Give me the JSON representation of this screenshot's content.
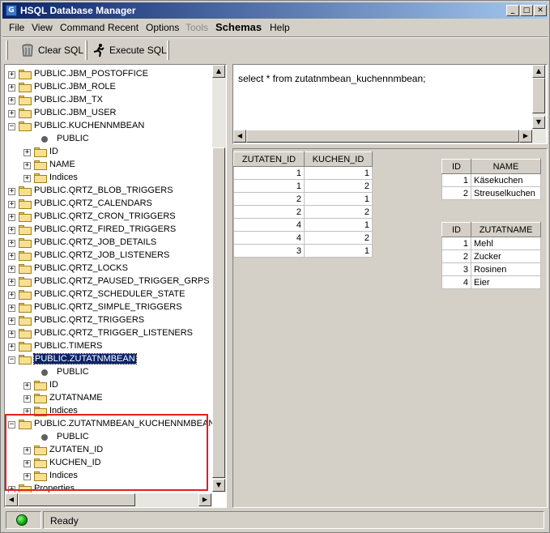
{
  "window": {
    "title": "HSQL Database Manager",
    "app_icon_glyph": "G"
  },
  "menu": {
    "items": [
      "File",
      "View",
      "Command",
      "Recent",
      "Options",
      "Tools",
      "Schemas",
      "Help"
    ]
  },
  "toolbar": {
    "clear_sql_label": "Clear SQL",
    "execute_sql_label": "Execute SQL"
  },
  "tree": {
    "rows": [
      {
        "label": "PUBLIC.JBM_POSTOFFICE",
        "kind": "folder",
        "level": 0,
        "exp": "+"
      },
      {
        "label": "PUBLIC.JBM_ROLE",
        "kind": "folder",
        "level": 0,
        "exp": "+"
      },
      {
        "label": "PUBLIC.JBM_TX",
        "kind": "folder",
        "level": 0,
        "exp": "+"
      },
      {
        "label": "PUBLIC.JBM_USER",
        "kind": "folder",
        "level": 0,
        "exp": "+"
      },
      {
        "label": "PUBLIC.KUCHENNMBEAN",
        "kind": "folder",
        "level": 0,
        "exp": "-"
      },
      {
        "label": "PUBLIC",
        "kind": "dot",
        "level": 1,
        "exp": ""
      },
      {
        "label": "ID",
        "kind": "folder",
        "level": 1,
        "exp": "+"
      },
      {
        "label": "NAME",
        "kind": "folder",
        "level": 1,
        "exp": "+"
      },
      {
        "label": "Indices",
        "kind": "folder",
        "level": 1,
        "exp": "+"
      },
      {
        "label": "PUBLIC.QRTZ_BLOB_TRIGGERS",
        "kind": "folder",
        "level": 0,
        "exp": "+"
      },
      {
        "label": "PUBLIC.QRTZ_CALENDARS",
        "kind": "folder",
        "level": 0,
        "exp": "+"
      },
      {
        "label": "PUBLIC.QRTZ_CRON_TRIGGERS",
        "kind": "folder",
        "level": 0,
        "exp": "+"
      },
      {
        "label": "PUBLIC.QRTZ_FIRED_TRIGGERS",
        "kind": "folder",
        "level": 0,
        "exp": "+"
      },
      {
        "label": "PUBLIC.QRTZ_JOB_DETAILS",
        "kind": "folder",
        "level": 0,
        "exp": "+"
      },
      {
        "label": "PUBLIC.QRTZ_JOB_LISTENERS",
        "kind": "folder",
        "level": 0,
        "exp": "+"
      },
      {
        "label": "PUBLIC.QRTZ_LOCKS",
        "kind": "folder",
        "level": 0,
        "exp": "+"
      },
      {
        "label": "PUBLIC.QRTZ_PAUSED_TRIGGER_GRPS",
        "kind": "folder",
        "level": 0,
        "exp": "+"
      },
      {
        "label": "PUBLIC.QRTZ_SCHEDULER_STATE",
        "kind": "folder",
        "level": 0,
        "exp": "+"
      },
      {
        "label": "PUBLIC.QRTZ_SIMPLE_TRIGGERS",
        "kind": "folder",
        "level": 0,
        "exp": "+"
      },
      {
        "label": "PUBLIC.QRTZ_TRIGGERS",
        "kind": "folder",
        "level": 0,
        "exp": "+"
      },
      {
        "label": "PUBLIC.QRTZ_TRIGGER_LISTENERS",
        "kind": "folder",
        "level": 0,
        "exp": "+"
      },
      {
        "label": "PUBLIC.TIMERS",
        "kind": "folder",
        "level": 0,
        "exp": "+"
      },
      {
        "label": "PUBLIC.ZUTATNMBEAN",
        "kind": "folder",
        "level": 0,
        "exp": "-",
        "selected": true
      },
      {
        "label": "PUBLIC",
        "kind": "dot",
        "level": 1,
        "exp": ""
      },
      {
        "label": "ID",
        "kind": "folder",
        "level": 1,
        "exp": "+"
      },
      {
        "label": "ZUTATNAME",
        "kind": "folder",
        "level": 1,
        "exp": "+"
      },
      {
        "label": "Indices",
        "kind": "folder",
        "level": 1,
        "exp": "+"
      },
      {
        "label": "PUBLIC.ZUTATNMBEAN_KUCHENNMBEAN",
        "kind": "folder",
        "level": 0,
        "exp": "-"
      },
      {
        "label": "PUBLIC",
        "kind": "dot",
        "level": 1,
        "exp": ""
      },
      {
        "label": "ZUTATEN_ID",
        "kind": "folder",
        "level": 1,
        "exp": "+"
      },
      {
        "label": "KUCHEN_ID",
        "kind": "folder",
        "level": 1,
        "exp": "+"
      },
      {
        "label": "Indices",
        "kind": "folder",
        "level": 1,
        "exp": "+"
      },
      {
        "label": "Properties",
        "kind": "folder",
        "level": 0,
        "exp": "+"
      }
    ]
  },
  "sql": {
    "query": "select * from zutatnmbean_kuchennmbean;"
  },
  "results": {
    "main": {
      "headers": [
        "ZUTATEN_ID",
        "KUCHEN_ID"
      ],
      "rows": [
        [
          "1",
          "1"
        ],
        [
          "1",
          "2"
        ],
        [
          "2",
          "1"
        ],
        [
          "2",
          "2"
        ],
        [
          "4",
          "1"
        ],
        [
          "4",
          "2"
        ],
        [
          "3",
          "1"
        ]
      ]
    },
    "kuchen": {
      "headers": [
        "ID",
        "NAME"
      ],
      "rows": [
        [
          "1",
          "Käsekuchen"
        ],
        [
          "2",
          "Streuselkuchen"
        ]
      ]
    },
    "zutaten": {
      "headers": [
        "ID",
        "ZUTATNAME"
      ],
      "rows": [
        [
          "1",
          "Mehl"
        ],
        [
          "2",
          "Zucker"
        ],
        [
          "3",
          "Rosinen"
        ],
        [
          "4",
          "Eier"
        ]
      ]
    }
  },
  "status": {
    "text": "Ready",
    "led_color": "#10a010"
  },
  "colors": {
    "titlebar_start": "#0a246a",
    "titlebar_end": "#a6caf0",
    "highlight_border": "#e02020"
  }
}
